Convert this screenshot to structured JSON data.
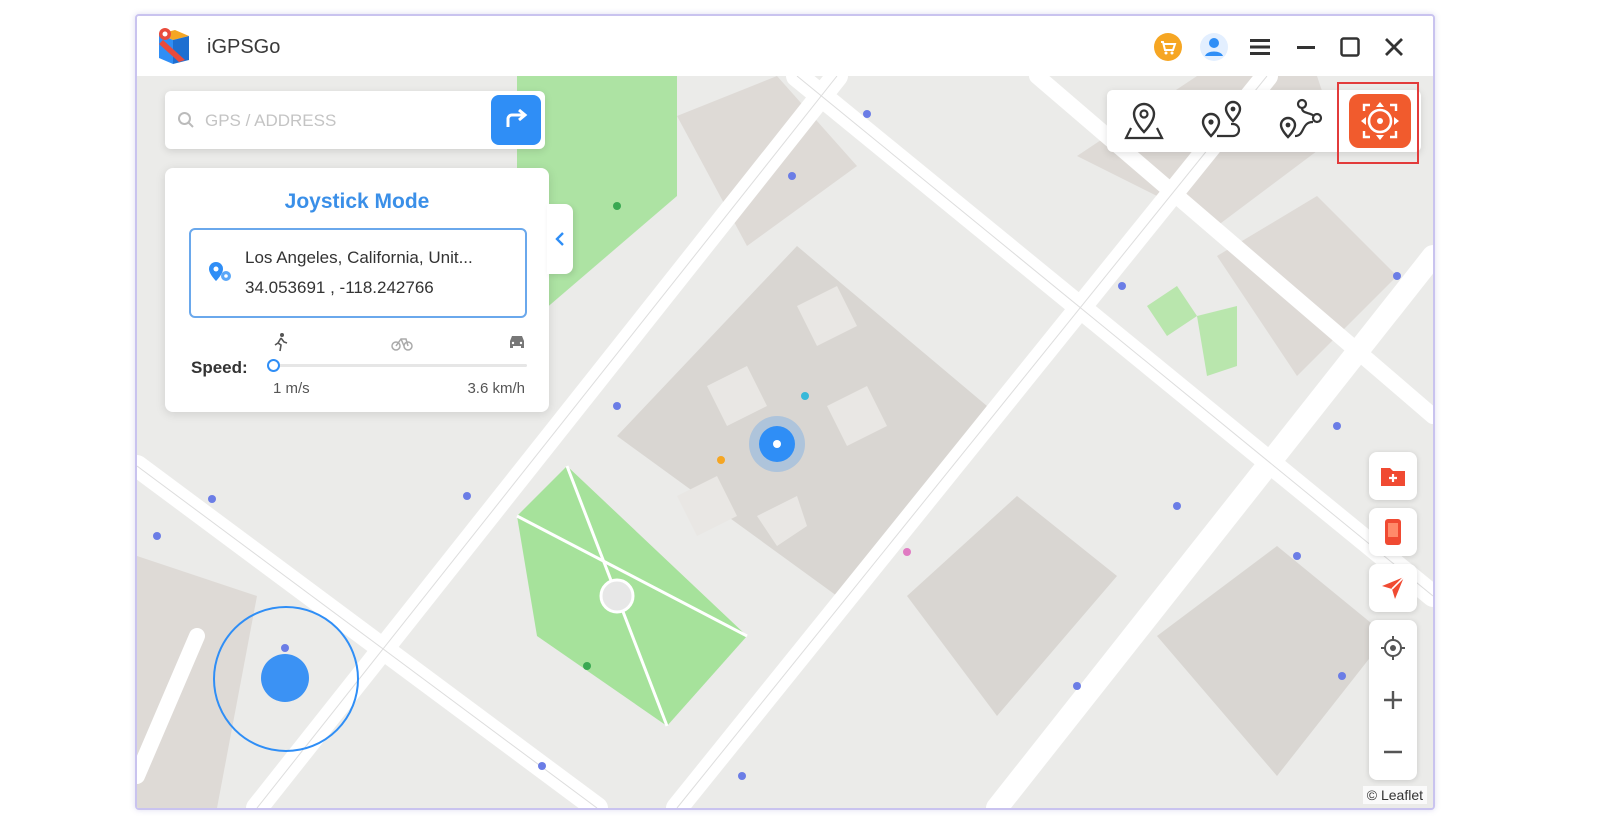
{
  "app": {
    "title": "iGPSGo"
  },
  "titlebar": {
    "buttons": [
      {
        "name": "cart-icon"
      },
      {
        "name": "user-icon"
      },
      {
        "name": "menu-icon"
      },
      {
        "name": "minimize-icon"
      },
      {
        "name": "maximize-icon"
      },
      {
        "name": "close-icon"
      }
    ]
  },
  "search": {
    "placeholder": "GPS / ADDRESS",
    "value": ""
  },
  "panel": {
    "title": "Joystick Mode",
    "location_name": "Los Angeles, California, Unit...",
    "coordinates": "34.053691 , -118.242766",
    "speed_label": "Speed:",
    "speed_min": "1 m/s",
    "speed_max": "3.6 km/h",
    "speed_level": 0.0,
    "speed_modes": [
      "walk-icon",
      "bike-icon",
      "car-icon"
    ]
  },
  "mode_bar": {
    "modes": [
      "teleport-icon",
      "two-spot-icon",
      "multi-spot-icon",
      "joystick-icon"
    ],
    "active": "joystick-icon"
  },
  "side_tools": [
    "favorites-folder-icon",
    "device-icon",
    "send-location-icon",
    "locate-icon",
    "zoom-in-icon",
    "zoom-out-icon"
  ],
  "map": {
    "attribution": "© Leaflet"
  },
  "colors": {
    "accent": "#2f8ef6",
    "active_mode": "#f15b2d",
    "highlight_border": "#e23b3b",
    "park": "#a6e29b"
  }
}
